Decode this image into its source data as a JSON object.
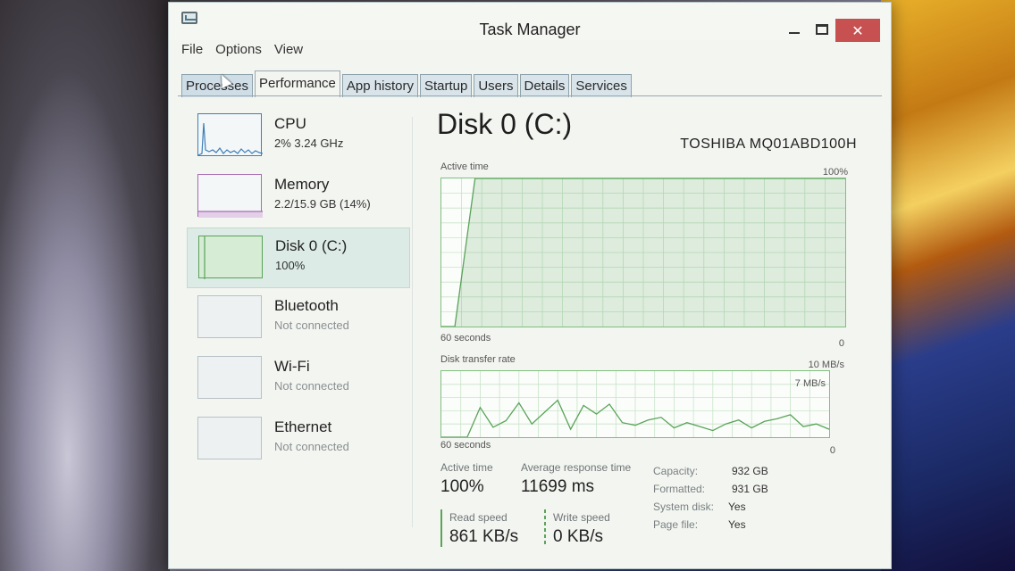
{
  "window": {
    "title": "Task Manager",
    "controls": {
      "minimize": "minimize",
      "maximize": "maximize",
      "close": "✕"
    }
  },
  "menu": [
    "File",
    "Options",
    "View"
  ],
  "tabs": [
    "Processes",
    "Performance",
    "App history",
    "Startup",
    "Users",
    "Details",
    "Services"
  ],
  "active_tab": "Performance",
  "sidebar": {
    "items": [
      {
        "title": "CPU",
        "sub": "2%  3.24 GHz",
        "thumb_color": "#3d7fb8"
      },
      {
        "title": "Memory",
        "sub": "2.2/15.9 GB (14%)",
        "thumb_color": "#a66cb3"
      },
      {
        "title": "Disk 0 (C:)",
        "sub": "100%",
        "thumb_color": "#5aa35a"
      },
      {
        "title": "Bluetooth",
        "sub": "Not connected",
        "thumb_color": "#b8c1c5"
      },
      {
        "title": "Wi-Fi",
        "sub": "Not connected",
        "thumb_color": "#b8c1c5"
      },
      {
        "title": "Ethernet",
        "sub": "Not connected",
        "thumb_color": "#b8c1c5"
      }
    ],
    "selected": "Disk 0 (C:)"
  },
  "main": {
    "title": "Disk 0 (C:)",
    "model": "TOSHIBA MQ01ABD100H",
    "active_time_graph": {
      "label": "Active time",
      "max_label": "100%",
      "x_left": "60 seconds",
      "x_right": "0",
      "accent": "#5aa35a"
    },
    "transfer_graph": {
      "label": "Disk transfer rate",
      "max_label": "10 MB/s",
      "mid_label": "7 MB/s",
      "x_left": "60 seconds",
      "x_right": "0"
    },
    "stats": {
      "active_time_label": "Active time",
      "active_time_value": "100%",
      "avg_response_label": "Average response time",
      "avg_response_value": "11699 ms",
      "read_speed_label": "Read speed",
      "read_speed_value": "861 KB/s",
      "write_speed_label": "Write speed",
      "write_speed_value": "0 KB/s",
      "capacity_label": "Capacity:",
      "capacity_value": "932 GB",
      "formatted_label": "Formatted:",
      "formatted_value": "931 GB",
      "system_disk_label": "System disk:",
      "system_disk_value": "Yes",
      "page_file_label": "Page file:",
      "page_file_value": "Yes"
    }
  },
  "chart_data": [
    {
      "type": "area",
      "title": "Active time",
      "ylabel": "",
      "ylim": [
        0,
        100
      ],
      "x": [
        60,
        58,
        55,
        50,
        40,
        30,
        20,
        10,
        0
      ],
      "values": [
        0,
        0,
        100,
        100,
        100,
        100,
        100,
        100,
        100
      ]
    },
    {
      "type": "line",
      "title": "Disk transfer rate",
      "ylim": [
        0,
        10
      ],
      "x": [
        60,
        58,
        56,
        54,
        52,
        50,
        48,
        46,
        44,
        42,
        40,
        38,
        36,
        34,
        32,
        30,
        28,
        26,
        24,
        22,
        20,
        18,
        16,
        14,
        12,
        10,
        8,
        6,
        4,
        2,
        0
      ],
      "values": [
        0,
        0,
        0,
        4.5,
        1.5,
        2.5,
        5.2,
        2.0,
        3.8,
        5.6,
        1.2,
        4.8,
        3.5,
        5.0,
        2.2,
        1.8,
        2.6,
        3.0,
        1.4,
        2.2,
        1.6,
        1.0,
        2.0,
        2.6,
        1.4,
        2.4,
        2.8,
        3.4,
        1.6,
        2.0,
        1.2
      ]
    }
  ]
}
